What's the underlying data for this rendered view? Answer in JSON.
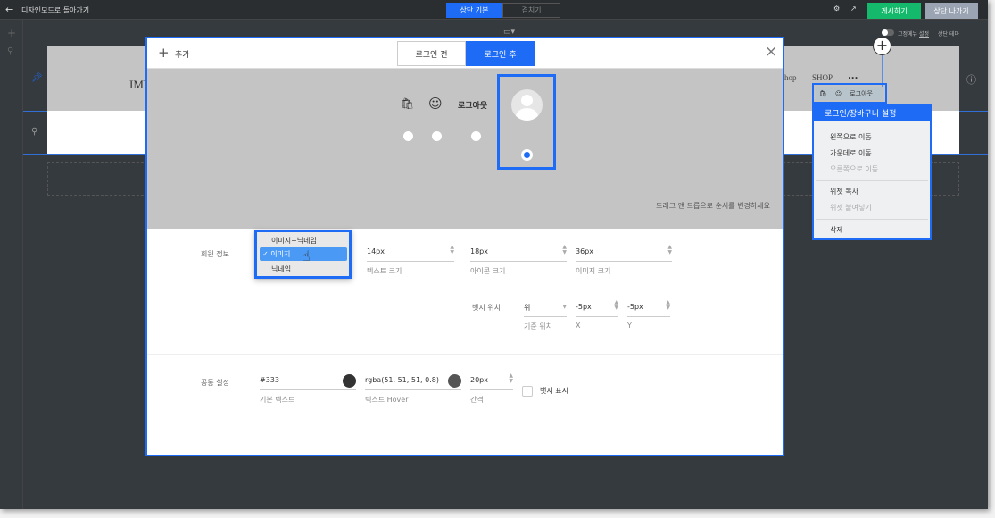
{
  "topbar": {
    "back_label": "디자인모드로 돌아가기",
    "tab_basic": "상단 기본",
    "tab_overlap": "겹치기",
    "publish": "게시하기",
    "exit": "상단 나가기"
  },
  "canvas": {
    "fixed_menu_label": "고정메뉴",
    "fixed_menu_link": "설정",
    "top_theme": "상단 테마",
    "logo_text": "IMV",
    "nav_shop_partial": "hop",
    "nav_shop": "SHOP",
    "nav_more": "...",
    "widget_logout": "로그아웃"
  },
  "context_menu": {
    "title": "로그인/장바구니 설정",
    "items": [
      {
        "label": "왼쪽으로 이동",
        "disabled": false
      },
      {
        "label": "가운데로 이동",
        "disabled": false
      },
      {
        "label": "오른쪽으로 이동",
        "disabled": true
      },
      {
        "label": "위젯 복사",
        "disabled": false
      },
      {
        "label": "위젯 붙여넣기",
        "disabled": true
      },
      {
        "label": "삭제",
        "disabled": false
      }
    ]
  },
  "modal": {
    "add_label": "추가",
    "tabs": [
      "로그인 전",
      "로그인 후"
    ],
    "active_tab": 1,
    "preview_logout": "로그아웃",
    "drag_hint": "드래그 앤 드롭으로 순서를 변경하세요",
    "member_info": {
      "label": "회원 정보",
      "options": [
        "이미지+닉네임",
        "이미지",
        "닉네임"
      ],
      "selected": "이미지",
      "text_size": {
        "value": "14px",
        "label": "텍스트 크기"
      },
      "icon_size": {
        "value": "18px",
        "label": "아이콘 크기"
      },
      "image_size": {
        "value": "36px",
        "label": "이미지 크기"
      }
    },
    "badge": {
      "label": "뱃지 위치",
      "position": {
        "value": "위",
        "label": "기준 위치"
      },
      "x": {
        "value": "-5px",
        "label": "X"
      },
      "y": {
        "value": "-5px",
        "label": "Y"
      }
    },
    "common": {
      "label": "공통 설정",
      "base_text": {
        "value": "#333",
        "label": "기본 텍스트",
        "color": "#333333"
      },
      "hover_text": {
        "value": "rgba(51, 51, 51, 0.8)",
        "label": "텍스트 Hover",
        "color": "#555555"
      },
      "gap": {
        "value": "20px",
        "label": "간격"
      },
      "badge_show": {
        "label": "뱃지 표시",
        "checked": false
      }
    }
  },
  "colors": {
    "accent": "#1e6cf5",
    "publish": "#14b96b",
    "exit": "#9aa4b3"
  }
}
